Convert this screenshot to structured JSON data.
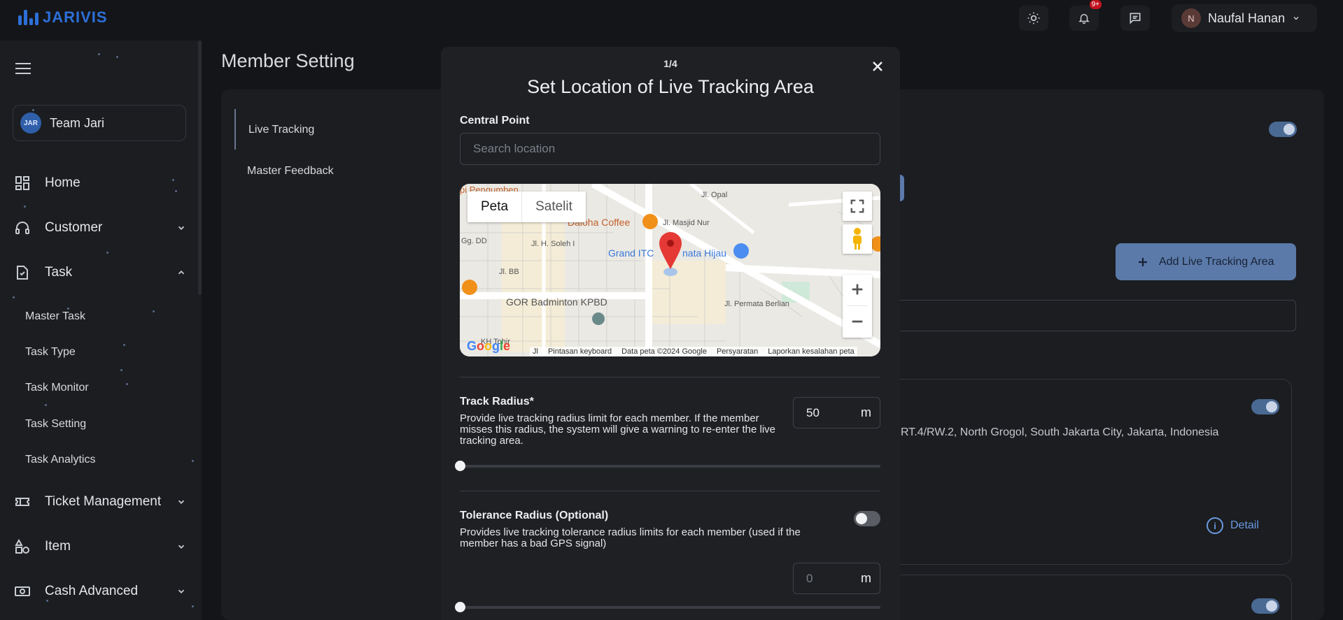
{
  "brand": {
    "name": "JARIVIS",
    "color": "#2d6fd8"
  },
  "topbar": {
    "theme_icon": "sun-icon",
    "notifications": {
      "icon": "bell-icon",
      "badge": "9+"
    },
    "messages_icon": "chat-icon",
    "user": {
      "initial": "N",
      "name": "Naufal Hanan"
    }
  },
  "sidebar": {
    "team": {
      "logo_text": "JAR",
      "name": "Team Jari"
    },
    "items": [
      {
        "label": "Home",
        "icon": "dashboard-icon"
      },
      {
        "label": "Customer",
        "icon": "headset-icon"
      },
      {
        "label": "Task",
        "icon": "task-icon"
      },
      {
        "label": "Ticket Management",
        "icon": "ticket-icon"
      },
      {
        "label": "Item",
        "icon": "shapes-icon"
      },
      {
        "label": "Cash Advanced",
        "icon": "cash-icon"
      }
    ],
    "task_subitems": [
      "Master Task",
      "Task Type",
      "Task Monitor",
      "Task Setting",
      "Task Analytics"
    ]
  },
  "page": {
    "title": "Member Setting",
    "tabs": [
      "Live Tracking",
      "Master Feedback"
    ],
    "add_button": "Add Live Tracking Area",
    "address": "RT.4/RW.2, North Grogol, South Jakarta City, Jakarta, Indonesia",
    "detail_link": "Detail"
  },
  "modal": {
    "step": "1/4",
    "title": "Set Location of Live Tracking Area",
    "central_point": {
      "label": "Central Point",
      "placeholder": "Search location",
      "value": ""
    },
    "map": {
      "tabs": [
        "Peta",
        "Satelit"
      ],
      "active_tab": "Peta",
      "labels": {
        "top_left": "pi Pengumben",
        "street1": "Jl. Opal",
        "street2": "Jl. Masjid Nur",
        "street3": "Jl. H. Soleh I",
        "street4": "Gg. DD",
        "street5": "Jl. BB",
        "street6": "Jl. Permata Berlian",
        "street7": "KH Tohir",
        "poi1": "Daloha Coffee",
        "poi2": "Grand ITC Permata Hijau",
        "poi2_visible": "Grand ITC",
        "poi2_visible_tail": "nata Hijau",
        "poi3": "GOR Badminton KPBD"
      },
      "footer": [
        "Pintasan keyboard",
        "Data peta ©2024 Google",
        "Persyaratan",
        "Laporkan kesalahan peta"
      ],
      "footer_prefix": "Jl"
    },
    "track_radius": {
      "label": "Track Radius*",
      "help": "Provide live tracking radius limit for each member. If the member misses this radius, the system will give a warning to re-enter the live tracking area.",
      "value": "50",
      "unit": "m",
      "slider_fraction": 0
    },
    "tolerance_radius": {
      "label": "Tolerance Radius (Optional)",
      "help": "Provides live tracking tolerance radius limits for each member (used if the member has a bad GPS signal)",
      "enabled": false,
      "value": "0",
      "unit": "m",
      "slider_fraction": 0
    }
  }
}
